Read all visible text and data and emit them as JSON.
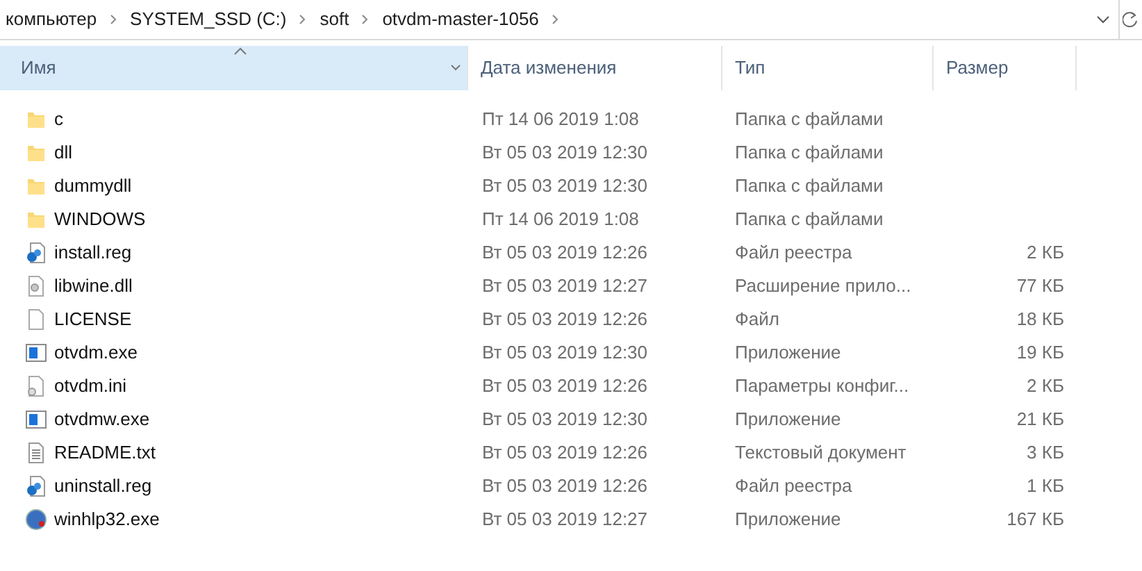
{
  "breadcrumb": [
    "компьютер",
    "SYSTEM_SSD (C:)",
    "soft",
    "otvdm-master-1056"
  ],
  "columns": [
    {
      "label": "Имя",
      "selected": true,
      "sorted": true
    },
    {
      "label": "Дата изменения",
      "selected": false,
      "sorted": false
    },
    {
      "label": "Тип",
      "selected": false,
      "sorted": false
    },
    {
      "label": "Размер",
      "selected": false,
      "sorted": false
    }
  ],
  "rows": [
    {
      "kind": "folder",
      "name": "c",
      "date": "Пт 14 06 2019 1:08",
      "type": "Папка с файлами"
    },
    {
      "kind": "folder",
      "name": "dll",
      "date": "Вт 05 03 2019 12:30",
      "type": "Папка с файлами"
    },
    {
      "kind": "folder",
      "name": "dummydll",
      "date": "Вт 05 03 2019 12:30",
      "type": "Папка с файлами"
    },
    {
      "kind": "folder",
      "name": "WINDOWS",
      "date": "Пт 14 06 2019 1:08",
      "type": "Папка с файлами"
    },
    {
      "kind": "reg",
      "name": "install.reg",
      "date": "Вт 05 03 2019 12:26",
      "type": "Файл реестра",
      "size": "2 КБ"
    },
    {
      "kind": "dll",
      "name": "libwine.dll",
      "date": "Вт 05 03 2019 12:27",
      "type": "Расширение прило...",
      "size": "77 КБ"
    },
    {
      "kind": "file",
      "name": "LICENSE",
      "date": "Вт 05 03 2019 12:26",
      "type": "Файл",
      "size": "18 КБ"
    },
    {
      "kind": "exe",
      "name": "otvdm.exe",
      "date": "Вт 05 03 2019 12:30",
      "type": "Приложение",
      "size": "19 КБ"
    },
    {
      "kind": "ini",
      "name": "otvdm.ini",
      "date": "Вт 05 03 2019 12:26",
      "type": "Параметры конфиг...",
      "size": "2 КБ"
    },
    {
      "kind": "exe",
      "name": "otvdmw.exe",
      "date": "Вт 05 03 2019 12:30",
      "type": "Приложение",
      "size": "21 КБ"
    },
    {
      "kind": "txt",
      "name": "README.txt",
      "date": "Вт 05 03 2019 12:26",
      "type": "Текстовый документ",
      "size": "3 КБ"
    },
    {
      "kind": "reg",
      "name": "uninstall.reg",
      "date": "Вт 05 03 2019 12:26",
      "type": "Файл реестра",
      "size": "1 КБ"
    },
    {
      "kind": "help",
      "name": "winhlp32.exe",
      "date": "Вт 05 03 2019 12:27",
      "type": "Приложение",
      "size": "167 КБ"
    }
  ]
}
